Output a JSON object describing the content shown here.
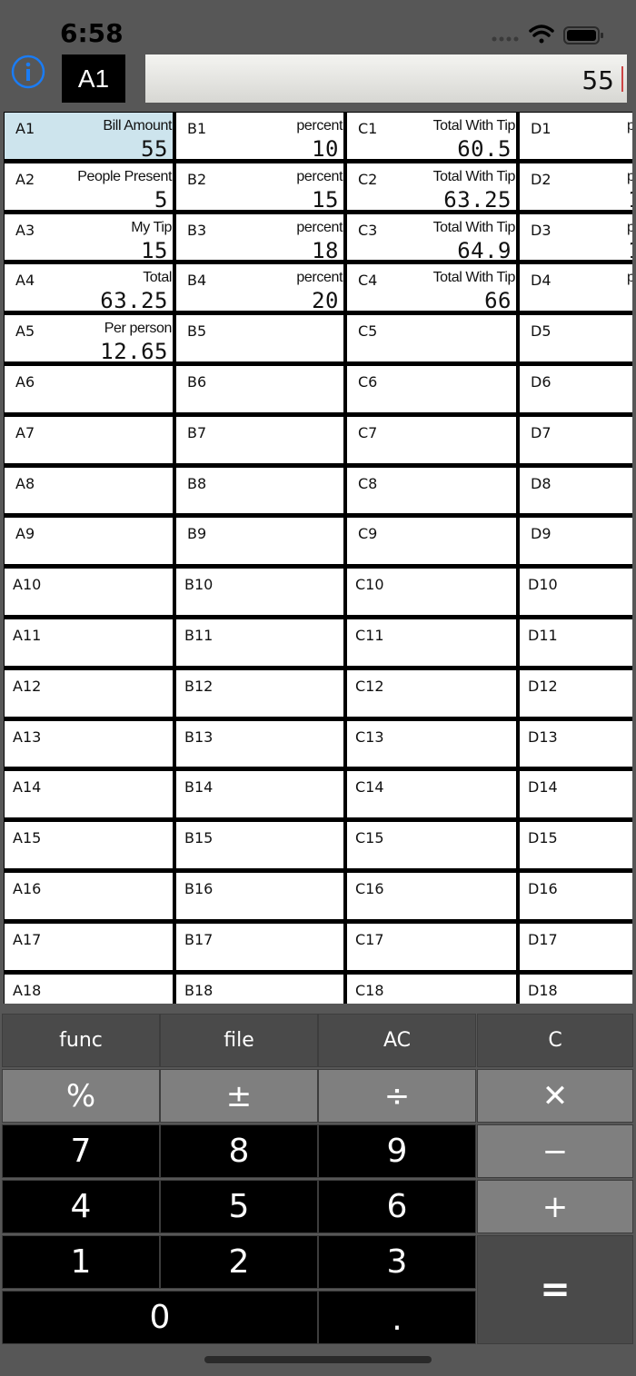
{
  "status_bar": {
    "time": "6:58"
  },
  "top_bar": {
    "info_icon": "info-circle-icon",
    "cell_reference": "A1",
    "formula_value": "55"
  },
  "sheet": {
    "columns": [
      "A",
      "B",
      "C",
      "D"
    ],
    "rows": [
      [
        {
          "ref": "A1",
          "label": "Bill Amount",
          "value": "55",
          "selected": true
        },
        {
          "ref": "B1",
          "label": "percent",
          "value": "10"
        },
        {
          "ref": "C1",
          "label": "Total With Tip",
          "value": "60.5"
        },
        {
          "ref": "D1",
          "label": "p",
          "value": ""
        }
      ],
      [
        {
          "ref": "A2",
          "label": "People Present",
          "value": "5"
        },
        {
          "ref": "B2",
          "label": "percent",
          "value": "15"
        },
        {
          "ref": "C2",
          "label": "Total With Tip",
          "value": "63.25"
        },
        {
          "ref": "D2",
          "label": "p",
          "value": "1"
        }
      ],
      [
        {
          "ref": "A3",
          "label": "My Tip",
          "value": "15"
        },
        {
          "ref": "B3",
          "label": "percent",
          "value": "18"
        },
        {
          "ref": "C3",
          "label": "Total With Tip",
          "value": "64.9"
        },
        {
          "ref": "D3",
          "label": "p",
          "value": "1"
        }
      ],
      [
        {
          "ref": "A4",
          "label": "Total",
          "value": "63.25"
        },
        {
          "ref": "B4",
          "label": "percent",
          "value": "20"
        },
        {
          "ref": "C4",
          "label": "Total With Tip",
          "value": "66"
        },
        {
          "ref": "D4",
          "label": "p",
          "value": ""
        }
      ],
      [
        {
          "ref": "A5",
          "label": "Per person",
          "value": "12.65"
        },
        {
          "ref": "B5",
          "label": "",
          "value": ""
        },
        {
          "ref": "C5",
          "label": "",
          "value": ""
        },
        {
          "ref": "D5",
          "label": "",
          "value": ""
        }
      ],
      [
        {
          "ref": "A6"
        },
        {
          "ref": "B6"
        },
        {
          "ref": "C6"
        },
        {
          "ref": "D6"
        }
      ],
      [
        {
          "ref": "A7"
        },
        {
          "ref": "B7"
        },
        {
          "ref": "C7"
        },
        {
          "ref": "D7"
        }
      ],
      [
        {
          "ref": "A8"
        },
        {
          "ref": "B8"
        },
        {
          "ref": "C8"
        },
        {
          "ref": "D8"
        }
      ],
      [
        {
          "ref": "A9"
        },
        {
          "ref": "B9"
        },
        {
          "ref": "C9"
        },
        {
          "ref": "D9"
        }
      ],
      [
        {
          "ref": "A10"
        },
        {
          "ref": "B10"
        },
        {
          "ref": "C10"
        },
        {
          "ref": "D10"
        }
      ],
      [
        {
          "ref": "A11"
        },
        {
          "ref": "B11"
        },
        {
          "ref": "C11"
        },
        {
          "ref": "D11"
        }
      ],
      [
        {
          "ref": "A12"
        },
        {
          "ref": "B12"
        },
        {
          "ref": "C12"
        },
        {
          "ref": "D12"
        }
      ],
      [
        {
          "ref": "A13"
        },
        {
          "ref": "B13"
        },
        {
          "ref": "C13"
        },
        {
          "ref": "D13"
        }
      ],
      [
        {
          "ref": "A14"
        },
        {
          "ref": "B14"
        },
        {
          "ref": "C14"
        },
        {
          "ref": "D14"
        }
      ],
      [
        {
          "ref": "A15"
        },
        {
          "ref": "B15"
        },
        {
          "ref": "C15"
        },
        {
          "ref": "D15"
        }
      ],
      [
        {
          "ref": "A16"
        },
        {
          "ref": "B16"
        },
        {
          "ref": "C16"
        },
        {
          "ref": "D16"
        }
      ],
      [
        {
          "ref": "A17"
        },
        {
          "ref": "B17"
        },
        {
          "ref": "C17"
        },
        {
          "ref": "D17"
        }
      ],
      [
        {
          "ref": "A18"
        },
        {
          "ref": "B18"
        },
        {
          "ref": "C18"
        },
        {
          "ref": "D18"
        }
      ]
    ]
  },
  "keypad": {
    "keys": [
      {
        "label": "func",
        "kind": "func",
        "name": "func-key"
      },
      {
        "label": "file",
        "kind": "func",
        "name": "file-key"
      },
      {
        "label": "AC",
        "kind": "func",
        "name": "all-clear-key"
      },
      {
        "label": "C",
        "kind": "func",
        "name": "clear-key"
      },
      {
        "label": "%",
        "kind": "op",
        "name": "percent-key"
      },
      {
        "label": "±",
        "kind": "op",
        "name": "plus-minus-key"
      },
      {
        "label": "÷",
        "kind": "op",
        "name": "divide-key"
      },
      {
        "label": "✕",
        "kind": "op",
        "name": "multiply-key"
      },
      {
        "label": "7",
        "kind": "num",
        "name": "digit-7-key"
      },
      {
        "label": "8",
        "kind": "num",
        "name": "digit-8-key"
      },
      {
        "label": "9",
        "kind": "num",
        "name": "digit-9-key"
      },
      {
        "label": "−",
        "kind": "op",
        "name": "minus-key"
      },
      {
        "label": "4",
        "kind": "num",
        "name": "digit-4-key"
      },
      {
        "label": "5",
        "kind": "num",
        "name": "digit-5-key"
      },
      {
        "label": "6",
        "kind": "num",
        "name": "digit-6-key"
      },
      {
        "label": "+",
        "kind": "op",
        "name": "plus-key"
      },
      {
        "label": "1",
        "kind": "num",
        "name": "digit-1-key"
      },
      {
        "label": "2",
        "kind": "num",
        "name": "digit-2-key"
      },
      {
        "label": "3",
        "kind": "num",
        "name": "digit-3-key"
      },
      {
        "label": "=",
        "kind": "eq",
        "name": "equals-key"
      },
      {
        "label": "0",
        "kind": "num",
        "name": "digit-0-key"
      },
      {
        "label": ".",
        "kind": "num",
        "name": "decimal-key"
      }
    ]
  },
  "colors": {
    "background": "#575757",
    "selected_cell": "#cde4ed",
    "info_icon": "#1a7cf5",
    "operator_key": "#7f7f7f",
    "function_key": "#4a4a4a",
    "number_key": "#000000"
  }
}
